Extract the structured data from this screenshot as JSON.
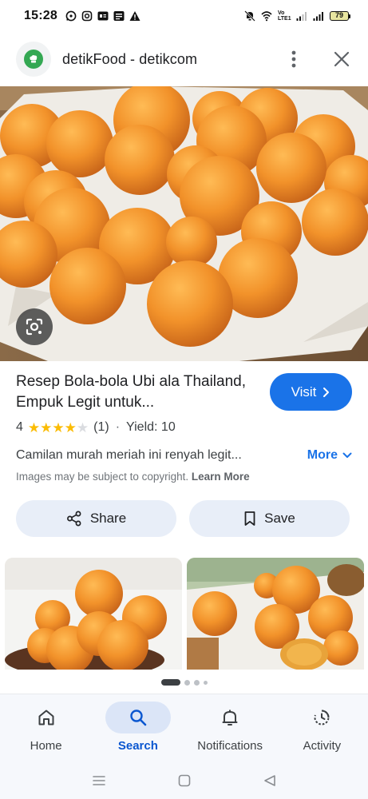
{
  "status_bar": {
    "time": "15:28",
    "battery": "79",
    "network_label": "Vo LTE1"
  },
  "header": {
    "title": "detikFood - detikcom"
  },
  "recipe": {
    "title": "Resep Bola-bola Ubi ala Thailand, Empuk Legit untuk...",
    "rating_value": "4",
    "rating_stars": 4,
    "rating_count": "(1)",
    "separator": "·",
    "yield": "Yield: 10",
    "description": "Camilan murah meriah ini renyah legit...",
    "more_label": "More",
    "visit_label": "Visit",
    "copyright_text": "Images may be subject to copyright.",
    "learn_more": "Learn More"
  },
  "actions": {
    "share_label": "Share",
    "save_label": "Save"
  },
  "bottom_nav": {
    "items": [
      {
        "label": "Home",
        "icon": "home-icon"
      },
      {
        "label": "Search",
        "icon": "search-icon",
        "active": true
      },
      {
        "label": "Notifications",
        "icon": "bell-icon"
      },
      {
        "label": "Activity",
        "icon": "activity-icon"
      }
    ]
  },
  "colors": {
    "accent": "#1a73e8",
    "pill_bg": "#e8eef8",
    "nav_active_bg": "#dbe5f7",
    "star": "#fbbc04"
  }
}
